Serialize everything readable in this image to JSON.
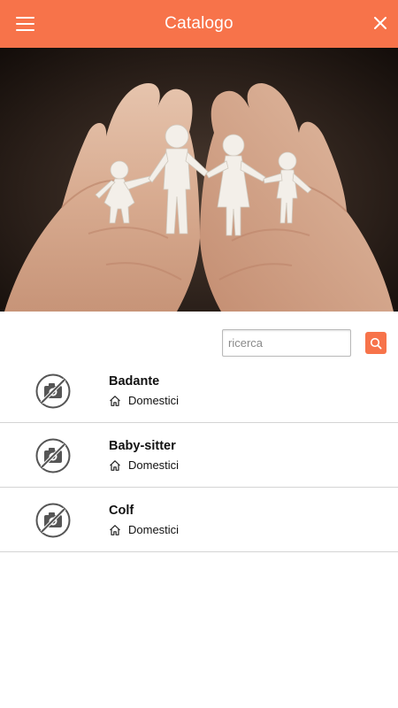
{
  "header": {
    "title": "Catalogo",
    "menu_icon": "hamburger-menu-icon",
    "close_icon": "close-icon",
    "accent_color": "#f7734a"
  },
  "hero": {
    "image": "hands-holding-paper-family-cutout"
  },
  "search": {
    "placeholder": "ricerca",
    "value": "",
    "button_icon": "search-icon"
  },
  "items": [
    {
      "name": "Badante",
      "category": "Domestici",
      "thumb_icon": "no-photo-icon",
      "category_icon": "home-icon"
    },
    {
      "name": "Baby-sitter",
      "category": "Domestici",
      "thumb_icon": "no-photo-icon",
      "category_icon": "home-icon"
    },
    {
      "name": "Colf",
      "category": "Domestici",
      "thumb_icon": "no-photo-icon",
      "category_icon": "home-icon"
    }
  ]
}
